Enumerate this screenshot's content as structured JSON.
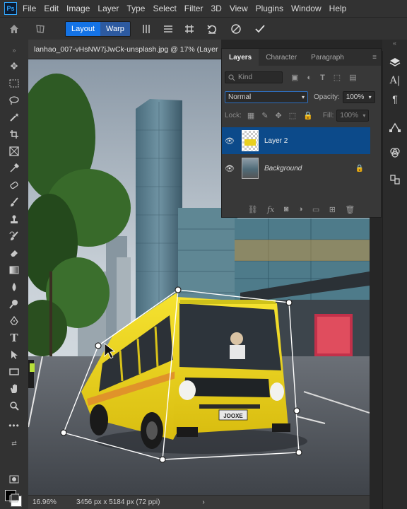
{
  "menubar": {
    "logo": "Ps",
    "items": [
      "File",
      "Edit",
      "Image",
      "Layer",
      "Type",
      "Select",
      "Filter",
      "3D",
      "View",
      "Plugins",
      "Window",
      "Help"
    ]
  },
  "options_bar": {
    "home_icon": "home-icon",
    "transform_icon": "warp-transform-icon",
    "layout_label": "Layout",
    "warp_label": "Warp",
    "icons": [
      "split-vertical-icon",
      "split-horizontal-icon",
      "grid-split-icon",
      "reset-icon",
      "cancel-icon",
      "commit-icon"
    ]
  },
  "document": {
    "tab_title": "lanhao_007-vHsNW7jJwCk-unsplash.jpg @ 17% (Layer"
  },
  "status_bar": {
    "zoom": "16.96%",
    "doc_info": "3456 px x 5184 px (72 ppi)",
    "arrow": "›"
  },
  "layers_panel": {
    "tabs": [
      "Layers",
      "Character",
      "Paragraph"
    ],
    "active_tab": "Layers",
    "kind_placeholder": "Kind",
    "blend_mode": "Normal",
    "opacity_label": "Opacity:",
    "opacity_value": "100%",
    "lock_label": "Lock:",
    "fill_label": "Fill:",
    "fill_value": "100%",
    "layers": [
      {
        "name": "Layer 2",
        "selected": true,
        "visible": true,
        "locked": false
      },
      {
        "name": "Background",
        "selected": false,
        "visible": true,
        "locked": true
      }
    ]
  },
  "tools": [
    "move-tool",
    "marquee-tool",
    "lasso-tool",
    "magic-wand-tool",
    "crop-tool",
    "frame-tool",
    "eyedropper-tool",
    "healing-brush-tool",
    "brush-tool",
    "clone-stamp-tool",
    "history-brush-tool",
    "eraser-tool",
    "gradient-tool",
    "blur-tool",
    "dodge-tool",
    "pen-tool",
    "type-tool",
    "path-selection-tool",
    "rectangle-tool",
    "hand-tool",
    "zoom-tool",
    "more-tools"
  ],
  "colors": {
    "accent": "#1473e6",
    "selected_layer": "#0c4a8a",
    "chrome": "#323232"
  },
  "bus": {
    "plate": "JOOXE"
  }
}
